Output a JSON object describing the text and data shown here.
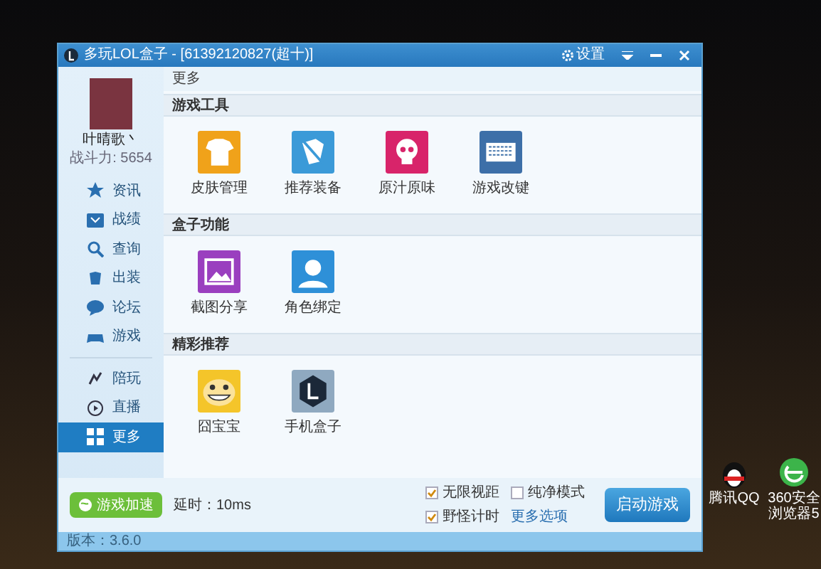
{
  "window": {
    "title": "多玩LOL盒子 - [61392120827(超十)]",
    "settings_label": "设置"
  },
  "user": {
    "name": "叶晴歌丶",
    "power": "战斗力: 5654"
  },
  "nav": [
    {
      "label": "资讯",
      "selected": false
    },
    {
      "label": "战绩",
      "selected": false
    },
    {
      "label": "查询",
      "selected": false
    },
    {
      "label": "出装",
      "selected": false
    },
    {
      "label": "论坛",
      "selected": false
    },
    {
      "label": "游戏",
      "selected": false
    }
  ],
  "nav_extra": [
    {
      "label": "陪玩",
      "selected": false
    },
    {
      "label": "直播",
      "selected": false
    },
    {
      "label": "更多",
      "selected": true
    }
  ],
  "breadcrumb": "更多",
  "sections": [
    {
      "title": "游戏工具",
      "tools": [
        {
          "label": "皮肤管理"
        },
        {
          "label": "推荐装备"
        },
        {
          "label": "原汁原味"
        },
        {
          "label": "游戏改键"
        }
      ]
    },
    {
      "title": "盒子功能",
      "tools": [
        {
          "label": "截图分享"
        },
        {
          "label": "角色绑定"
        }
      ]
    },
    {
      "title": "精彩推荐",
      "tools": [
        {
          "label": "囧宝宝"
        },
        {
          "label": "手机盒子"
        }
      ]
    }
  ],
  "bottom": {
    "accelerate_button": "游戏加速",
    "latency": "延时：10ms",
    "options": [
      {
        "label": "无限视距",
        "checked": true
      },
      {
        "label": "纯净模式",
        "checked": false
      },
      {
        "label": "野怪计时",
        "checked": true
      }
    ],
    "more_options": "更多选项",
    "launch_button": "启动游戏"
  },
  "status_bar": "版本：3.6.0",
  "desktop_icons": [
    {
      "label": "腾讯QQ"
    },
    {
      "label": "360安全浏览器5"
    }
  ]
}
